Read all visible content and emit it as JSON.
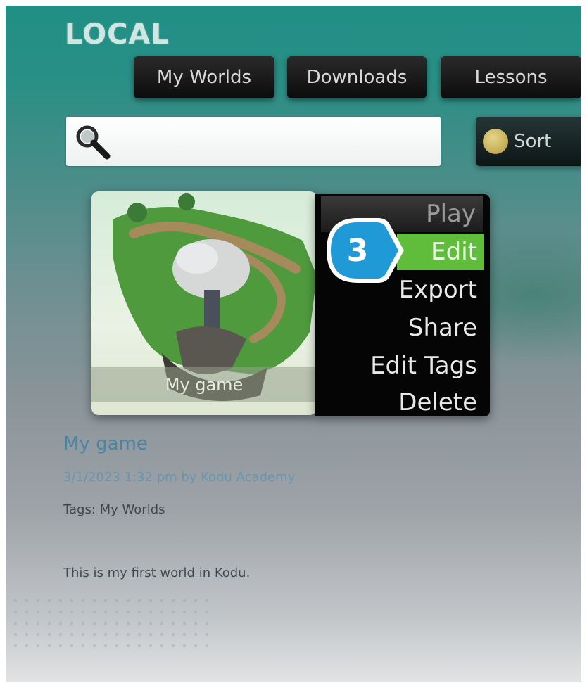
{
  "section": {
    "title": "LOCAL"
  },
  "tabs": [
    {
      "label": "My Worlds"
    },
    {
      "label": "Downloads"
    },
    {
      "label": "Lessons"
    }
  ],
  "search": {
    "value": "",
    "placeholder": ""
  },
  "sort": {
    "label": "Sort"
  },
  "world_card": {
    "thumbnail_caption": "My game",
    "title": "My game",
    "meta": "3/1/2023 1:32 pm by Kodu Academy",
    "tags": "Tags: My Worlds",
    "description": "This is my first world in Kodu."
  },
  "context_menu": {
    "items": [
      {
        "label": "Play"
      },
      {
        "label": "Edit"
      },
      {
        "label": "Export"
      },
      {
        "label": "Share"
      },
      {
        "label": "Edit Tags"
      },
      {
        "label": "Delete"
      }
    ],
    "highlighted": "Edit"
  },
  "callout": {
    "number": "3",
    "color": "#1f9ad6"
  },
  "colors": {
    "highlight": "#5fbd3b",
    "menu_bg": "#050505",
    "header_teal": "#1f8f85"
  }
}
